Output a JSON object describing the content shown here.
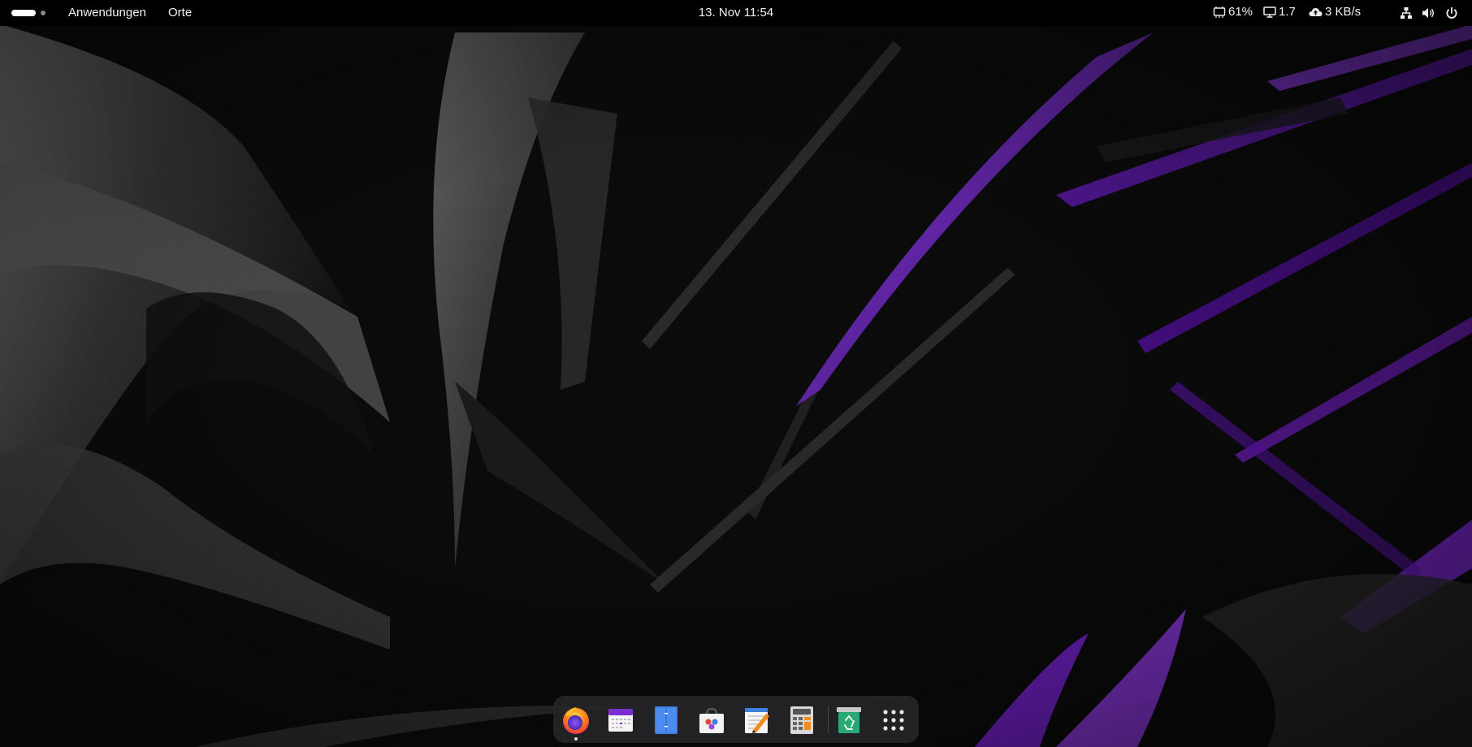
{
  "topbar": {
    "menus": [
      "Anwendungen",
      "Orte"
    ],
    "clock": "13. Nov  11:54",
    "indicators": {
      "cpu": "61%",
      "load": "1.7",
      "network_speed": "3 KB/s"
    }
  },
  "dock": {
    "apps": [
      "firefox",
      "calendar",
      "files",
      "software-center",
      "text-editor",
      "calculator",
      "trash",
      "show-apps"
    ]
  },
  "colors": {
    "topbar_bg": "#000000",
    "accent_purple": "#7b22d6",
    "dock_bg": "#262628"
  }
}
